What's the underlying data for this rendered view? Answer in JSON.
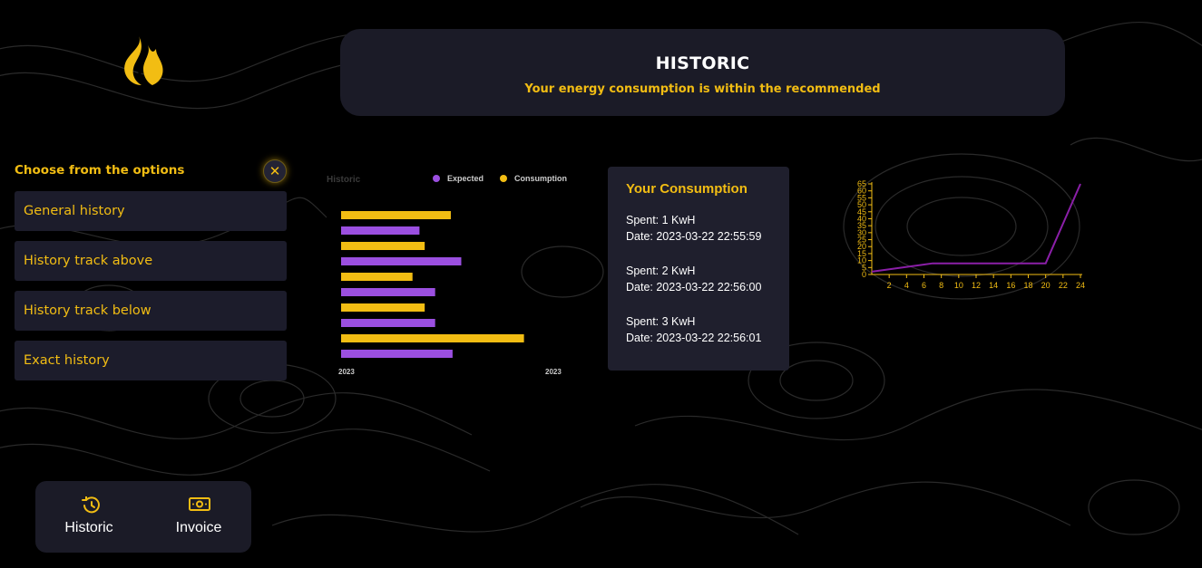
{
  "header": {
    "title": "HISTORIC",
    "subtitle": "Your energy consumption is within the recommended"
  },
  "sidebar": {
    "title": "Choose from the options",
    "close_icon": "close-icon",
    "options": [
      {
        "label": "General history"
      },
      {
        "label": "History track above"
      },
      {
        "label": "History track below"
      },
      {
        "label": "Exact history"
      }
    ]
  },
  "bottom_nav": {
    "items": [
      {
        "label": "Historic",
        "icon": "history-icon"
      },
      {
        "label": "Invoice",
        "icon": "banknote-icon"
      }
    ]
  },
  "consumption_card": {
    "title": "Your Consumption",
    "entries": [
      {
        "spent": "Spent: 1 KwH",
        "date": "Date: 2023-03-22 22:55:59"
      },
      {
        "spent": "Spent: 2 KwH",
        "date": "Date: 2023-03-22 22:56:00"
      },
      {
        "spent": "Spent: 3 KwH",
        "date": "Date: 2023-03-22 22:56:01"
      }
    ]
  },
  "colors": {
    "accent": "#f2bd13",
    "purple": "#9b4fe0",
    "line": "#8b1fa8",
    "card": "#1b1b27"
  },
  "chart_data": [
    {
      "type": "bar",
      "orientation": "horizontal",
      "title": "Historic",
      "legend_position": "top-right",
      "series": [
        {
          "name": "Consumption",
          "color": "#f2bd13",
          "values": [
            63,
            48,
            41,
            48,
            105
          ]
        },
        {
          "name": "Expected",
          "color": "#9b4fe0",
          "values": [
            45,
            69,
            54,
            54,
            64
          ]
        }
      ],
      "x_tick_labels": [
        "2023",
        "2023"
      ],
      "xlim": [
        0,
        125
      ]
    },
    {
      "type": "line",
      "color": "#8b1fa8",
      "x": [
        0,
        7,
        20,
        24
      ],
      "y": [
        2,
        8,
        8,
        65
      ],
      "xticks": [
        2,
        4,
        6,
        8,
        10,
        12,
        14,
        16,
        18,
        20,
        22,
        24
      ],
      "yticks": [
        0,
        5,
        10,
        15,
        20,
        25,
        30,
        35,
        40,
        45,
        50,
        55,
        60,
        65
      ],
      "xlim": [
        0,
        24
      ],
      "ylim": [
        0,
        65
      ]
    }
  ]
}
